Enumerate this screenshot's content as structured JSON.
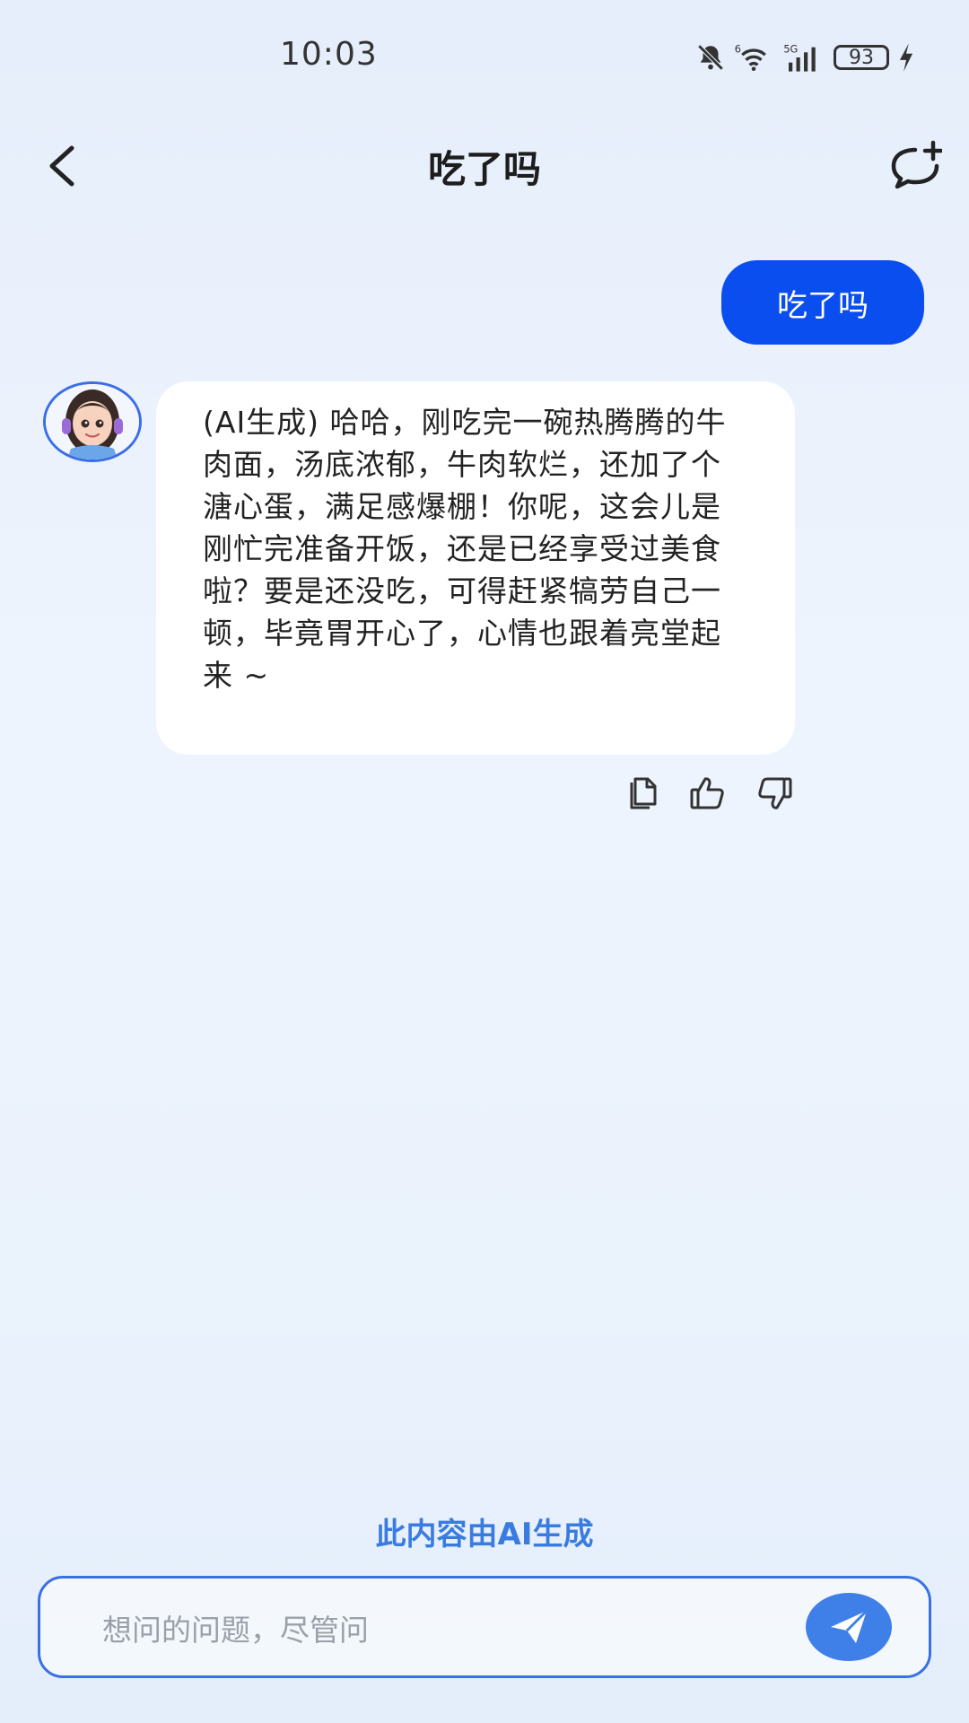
{
  "status_bar": {
    "time": "10:03",
    "battery": "93",
    "icons": [
      "bell-muted-icon",
      "wifi-icon",
      "signal-5g-icon",
      "battery-icon",
      "charging-icon"
    ]
  },
  "header": {
    "title": "吃了吗",
    "back_icon": "chevron-left-icon",
    "new_chat_icon": "chat-plus-icon"
  },
  "messages": [
    {
      "role": "user",
      "text": "吃了吗"
    },
    {
      "role": "ai",
      "text": "(AI生成) 哈哈，刚吃完一碗热腾腾的牛肉面，汤底浓郁，牛肉软烂，还加了个溏心蛋，满足感爆棚！你呢，这会儿是刚忙完准备开饭，还是已经享受过美食啦？要是还没吃，可得赶紧犒劳自己一顿，毕竟胃开心了，心情也跟着亮堂起来 ~"
    }
  ],
  "message_actions": [
    "copy-icon",
    "thumbs-up-icon",
    "thumbs-down-icon"
  ],
  "disclaimer": "此内容由AI生成",
  "composer": {
    "placeholder": "想问的问题，尽管问",
    "value": "",
    "send_icon": "paper-plane-icon"
  },
  "colors": {
    "accent": "#0b4ef0",
    "send_button": "#3f7fe8",
    "disclaimer": "#3a7be0",
    "input_border": "#3b6fe6"
  }
}
